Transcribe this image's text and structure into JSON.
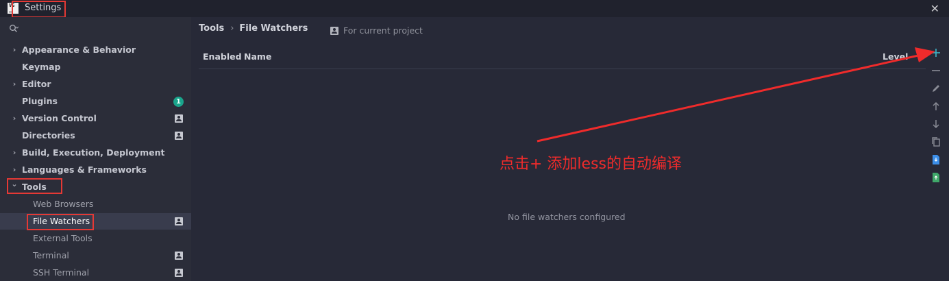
{
  "window": {
    "title": "Settings",
    "logo_text": "VS"
  },
  "search": {
    "placeholder": ""
  },
  "sidebar": {
    "items": [
      {
        "label": "Appearance & Behavior",
        "expandable": true,
        "expanded": false,
        "level": 0
      },
      {
        "label": "Keymap",
        "expandable": false,
        "level": 0
      },
      {
        "label": "Editor",
        "expandable": true,
        "expanded": false,
        "level": 0
      },
      {
        "label": "Plugins",
        "expandable": false,
        "level": 0,
        "badge": "1"
      },
      {
        "label": "Version Control",
        "expandable": true,
        "expanded": false,
        "level": 0,
        "project_scope": true
      },
      {
        "label": "Directories",
        "expandable": false,
        "level": 0,
        "project_scope": true
      },
      {
        "label": "Build, Execution, Deployment",
        "expandable": true,
        "expanded": false,
        "level": 0
      },
      {
        "label": "Languages & Frameworks",
        "expandable": true,
        "expanded": false,
        "level": 0
      },
      {
        "label": "Tools",
        "expandable": true,
        "expanded": true,
        "level": 0
      },
      {
        "label": "Web Browsers",
        "level": 1
      },
      {
        "label": "File Watchers",
        "level": 1,
        "selected": true,
        "project_scope": true
      },
      {
        "label": "External Tools",
        "level": 1
      },
      {
        "label": "Terminal",
        "level": 1,
        "project_scope": true
      },
      {
        "label": "SSH Terminal",
        "level": 1,
        "project_scope": true
      }
    ]
  },
  "breadcrumb": {
    "parent": "Tools",
    "separator": "›",
    "current": "File Watchers"
  },
  "scope_hint": "For current project",
  "table": {
    "columns": [
      "Enabled",
      "Name",
      "Level"
    ],
    "empty_text": "No file watchers configured"
  },
  "toolbar": {
    "buttons": [
      "add-icon",
      "remove-icon",
      "edit-icon",
      "move-up-icon",
      "move-down-icon",
      "copy-icon",
      "import-icon",
      "export-icon"
    ]
  },
  "annotation": {
    "text": "点击+ 添加less的自动编译"
  },
  "colors": {
    "accent": "#1aa58c",
    "annotation": "#ef2b2b",
    "add_button": "#3fb6c8",
    "import_icon": "#3c8ee8",
    "export_icon": "#40a86a"
  }
}
